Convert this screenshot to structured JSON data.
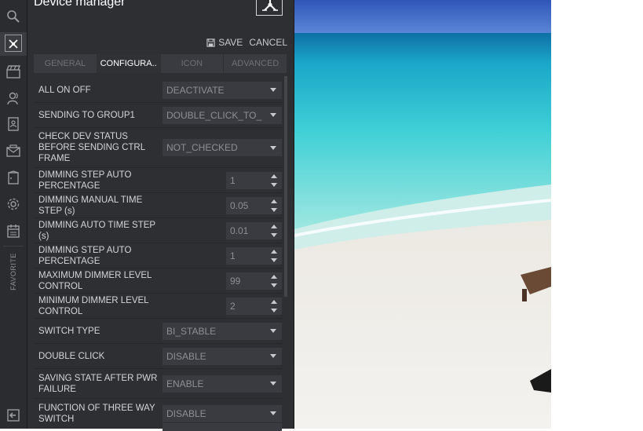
{
  "panel": {
    "title": "Device manager",
    "actions": {
      "save": "SAVE",
      "cancel": "CANCEL"
    },
    "tabs": [
      "GENERAL",
      "CONFIGURA..",
      "ICON",
      "ADVANCED"
    ],
    "active_tab": "CONFIGURA.."
  },
  "rail": {
    "items": [
      "search-icon",
      "device-manager-icon",
      "scene-clapper-icon",
      "users-icon",
      "contacts-book-icon",
      "messages-icon",
      "door-icon",
      "gear-icon",
      "calendar-icon"
    ],
    "favorite_label": "FAVORITE",
    "logout_icon": "logout-icon"
  },
  "form": {
    "rows": [
      {
        "label": "ALL ON OFF",
        "type": "select",
        "value": "DEACTIVATE"
      },
      {
        "label": "SENDING TO GROUP1",
        "type": "select",
        "value": "DOUBLE_CLICK_TO_"
      },
      {
        "label": "CHECK DEV STATUS BEFORE SENDING CTRL FRAME",
        "type": "select",
        "value": "NOT_CHECKED"
      },
      {
        "label": "DIMMING STEP AUTO PERCENTAGE",
        "type": "number",
        "value": "1"
      },
      {
        "label": "DIMMING MANUAL TIME STEP (s)",
        "type": "number",
        "value": "0.05"
      },
      {
        "label": "DIMMING AUTO TIME STEP (s)",
        "type": "number",
        "value": "0.01"
      },
      {
        "label": "DIMMING STEP AUTO PERCENTAGE",
        "type": "number",
        "value": "1"
      },
      {
        "label": "MAXIMUM DIMMER LEVEL CONTROL",
        "type": "number",
        "value": "99"
      },
      {
        "label": "MINIMUM DIMMER LEVEL CONTROL",
        "type": "number",
        "value": "2"
      },
      {
        "label": "SWITCH TYPE",
        "type": "select",
        "value": "BI_STABLE"
      },
      {
        "label": "DOUBLE CLICK",
        "type": "select",
        "value": "DISABLE"
      },
      {
        "label": "SAVING STATE AFTER PWR FAILURE",
        "type": "select",
        "value": "ENABLE"
      },
      {
        "label": "FUNCTION OF THREE WAY SWITCH",
        "type": "select",
        "value": "DISABLE"
      }
    ]
  },
  "colors": {
    "rail_bg": "#2b2c30",
    "panel_bg": "#2e2f33",
    "control_bg": "#3a3b40",
    "label_text": "#d4d5d8",
    "value_text": "#8d8f94"
  }
}
